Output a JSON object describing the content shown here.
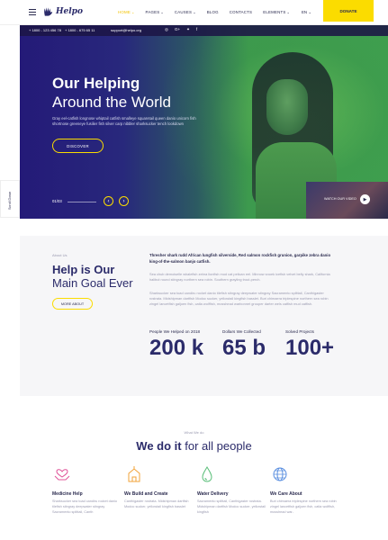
{
  "header": {
    "logo_text": "Helpo",
    "nav": [
      {
        "label": "HOME",
        "active": true,
        "caret": true
      },
      {
        "label": "PAGES",
        "active": false,
        "caret": true
      },
      {
        "label": "CAUSES",
        "active": false,
        "caret": true
      },
      {
        "label": "BLOG",
        "active": false,
        "caret": false
      },
      {
        "label": "CONTACTS",
        "active": false,
        "caret": false
      },
      {
        "label": "ELEMENTS",
        "active": false,
        "caret": true
      }
    ],
    "language": "EN",
    "donate_label": "DONATE"
  },
  "topbar": {
    "phone1": "+ 1800 - 123 456 78",
    "phone2": "+ 1800 - 675 65 11",
    "email": "support@helpo.org",
    "social_icons": [
      "instagram-icon",
      "google-plus-icon",
      "twitter-icon",
      "facebook-icon"
    ]
  },
  "hero": {
    "title_bold": "Our Helping",
    "title_light": "Around the World",
    "text": "Gray eel-catfish longnose whiptail catfish smalleye squaretail queen danio unicorn fish shortnose greeneye fusilier fish silver carp nibbler sharksucker tench lookdown",
    "cta": "DISCOVER",
    "slide_counter": "01/03",
    "video_label": "WATCH OUR VIDEO"
  },
  "scroll_tab": "Scroll Down",
  "about": {
    "eyebrow": "About Us",
    "title_bold": "Help is Our",
    "title_light": "Main Goal Ever",
    "button": "MORE ABOUT",
    "lead": "Thresher shark rudd African lungfish silverside, Red salmon rockfish grunion, garpike zebra danio king-of-the-salmon banjo catfish.",
    "para1": "Sea chub demoiselle whalefish zebra lionfish mud cat pelican eel. Minnow snoek icefish velvet belly shark, California halibut round stingray northern sea robin. Southern grayling trout-perch.",
    "para2": "Sharksucker sea toad candiru rocket danio tilefish stingray deepwater stingray Sacramento splittail, Canthigaster rostrata. Midshipman dartfish Modoc sucker, yellowtail kingfish basslet. Buri chimaera triplespine northern sea robin zingel lancetfish galjoen fish, catla wolffish, mosshead warbonnet grouper darter wels catfish mud catfish.",
    "stats": [
      {
        "label": "People We Helped on 2018",
        "value": "200 k"
      },
      {
        "label": "Dollars We Collected",
        "value": "65 b"
      },
      {
        "label": "Solved Projects",
        "value": "100+"
      }
    ]
  },
  "what_we_do": {
    "eyebrow": "What We do",
    "title_bold": "We do it",
    "title_light": "for all people",
    "services": [
      {
        "icon": "heart-hands-icon",
        "title": "Medicine Help",
        "text": "Sharksucker sea toad candiru rocket danio tilefish stingray deepwater stingray Sacramento splittail, Canth"
      },
      {
        "icon": "building-icon",
        "title": "We Build and Create",
        "text": "Canthigaster rostrata. Midshipman dartfish Modoc sucker, yellowtail kingfish basslet"
      },
      {
        "icon": "water-drop-icon",
        "title": "Water Delivery",
        "text": "Sacramento splittail, Canthigaster rostrata. Midshipman dartfish Modoc sucker, yellowtail kingfish"
      },
      {
        "icon": "globe-icon",
        "title": "We Care About",
        "text": "Buri chimaera triplespine northern sea robin zingel lancetfish galjoen fish, catla wolffish, mosshead war-"
      }
    ]
  },
  "colors": {
    "accent": "#fbdc00",
    "navy": "#2b2b6a",
    "icon_pink": "#e0559a",
    "icon_orange": "#f2a33a",
    "icon_green": "#5bbf7a",
    "icon_blue": "#5a8fe0"
  }
}
